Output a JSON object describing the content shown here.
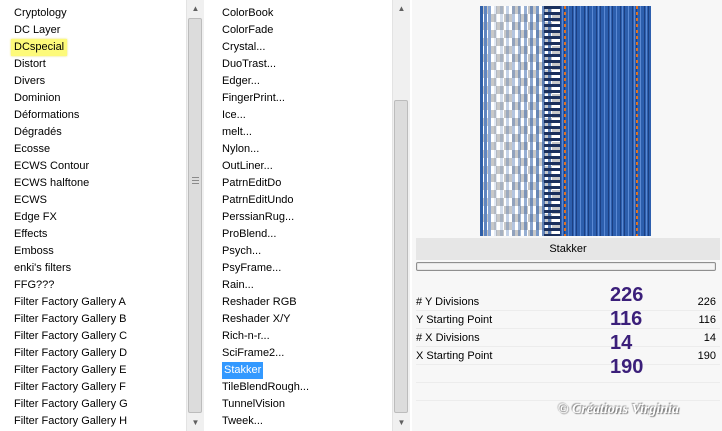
{
  "category_list": {
    "items": [
      "Cryptology",
      "DC Layer",
      "DCspecial",
      "Distort",
      "Divers",
      "Dominion",
      "Déformations",
      "Dégradés",
      "Ecosse",
      "ECWS Contour",
      "ECWS halftone",
      "ECWS",
      "Edge FX",
      "Effects",
      "Emboss",
      "enki's filters",
      "FFG???",
      "Filter Factory Gallery A",
      "Filter Factory Gallery B",
      "Filter Factory Gallery C",
      "Filter Factory Gallery D",
      "Filter Factory Gallery E",
      "Filter Factory Gallery F",
      "Filter Factory Gallery G",
      "Filter Factory Gallery H"
    ],
    "highlighted": "DCspecial"
  },
  "filter_list": {
    "items": [
      "ColorBook",
      "ColorFade",
      "Crystal...",
      "DuoTrast...",
      "Edger...",
      "FingerPrint...",
      "Ice...",
      "melt...",
      "Nylon...",
      "OutLiner...",
      "PatrnEditDo",
      "PatrnEditUndo",
      "PerssianRug...",
      "ProBlend...",
      "Psych...",
      "PsyFrame...",
      "Rain...",
      "Reshader RGB",
      "Reshader X/Y",
      "Rich-n-r...",
      "SciFrame2...",
      "Stakker",
      "TileBlendRough...",
      "TunnelVision",
      "Tweek..."
    ],
    "selected": "Stakker"
  },
  "settings": {
    "filter_name": "Stakker",
    "params": [
      {
        "label": "# Y Divisions",
        "value": "226"
      },
      {
        "label": "Y Starting Point",
        "value": "116"
      },
      {
        "label": "# X Divisions",
        "value": "14"
      },
      {
        "label": "X Starting Point",
        "value": "190"
      }
    ],
    "annotations": [
      "226",
      "116",
      "14",
      "190"
    ]
  },
  "watermark": "© Créations Virginia",
  "colors": {
    "highlight": "#fdfa7a",
    "selection": "#3399ff",
    "annotation": "#3b1f7a",
    "preview_blue": "#2f5fa8",
    "preview_orange": "#e07020"
  },
  "icons": {
    "scroll_up": "arrow-up-icon",
    "scroll_down": "arrow-down-icon"
  }
}
